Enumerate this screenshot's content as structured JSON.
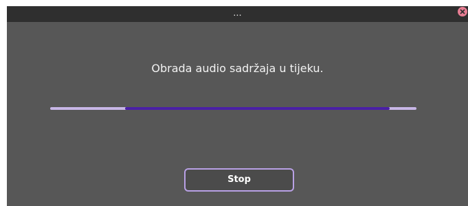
{
  "window": {
    "title": "..."
  },
  "dialog": {
    "message": "Obrada audio sadržaja u tijeku.",
    "progress": {
      "indeterminate": true
    },
    "stop_label": "Stop"
  },
  "icons": {
    "close": "close-icon"
  },
  "colors": {
    "titlebar": "#2f2f2f",
    "window_bg": "#575757",
    "progress_track": "#c8b6e6",
    "progress_fill": "#4a1fa6",
    "button_border": "#b9a1e6",
    "close_button": "#e77d93"
  }
}
